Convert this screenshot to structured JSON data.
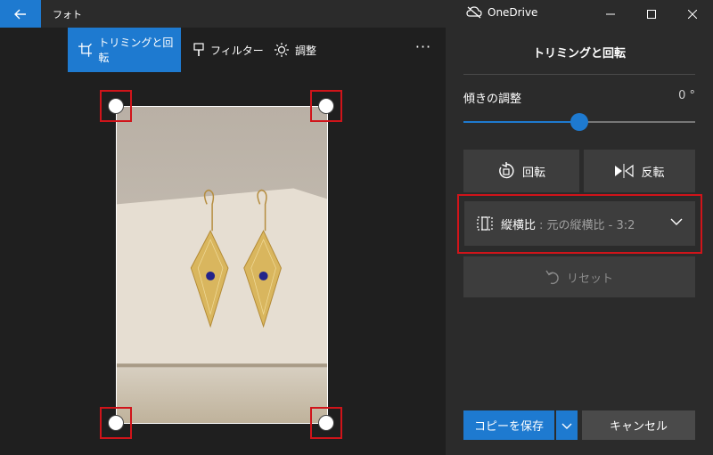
{
  "titlebar": {
    "app_title": "フォト",
    "onedrive_label": "OneDrive",
    "back_icon": "back-arrow-icon",
    "accent": "#1e7ad0"
  },
  "toolbar": {
    "tabs": [
      {
        "label": "トリミングと回転",
        "icon": "crop-icon",
        "active": true
      },
      {
        "label": "フィルター",
        "icon": "filter-brush-icon",
        "active": false
      },
      {
        "label": "調整",
        "icon": "brightness-icon",
        "active": false
      }
    ],
    "more_label": "···"
  },
  "panel": {
    "title": "トリミングと回転",
    "tilt": {
      "label": "傾きの調整",
      "value": "0 °",
      "slider_fraction": 0.5
    },
    "rotate_label": "回転",
    "flip_label": "反転",
    "aspect": {
      "label": "縦横比",
      "value": ": 元の縦横比 - 3:2"
    },
    "reset_label": "リセット",
    "save_label": "コピーを保存",
    "cancel_label": "キャンセル"
  },
  "colors": {
    "accent": "#1e7ad0",
    "highlight": "#d0141a",
    "panel_bg": "#2b2b2b",
    "button_bg": "#3d3d3d"
  }
}
